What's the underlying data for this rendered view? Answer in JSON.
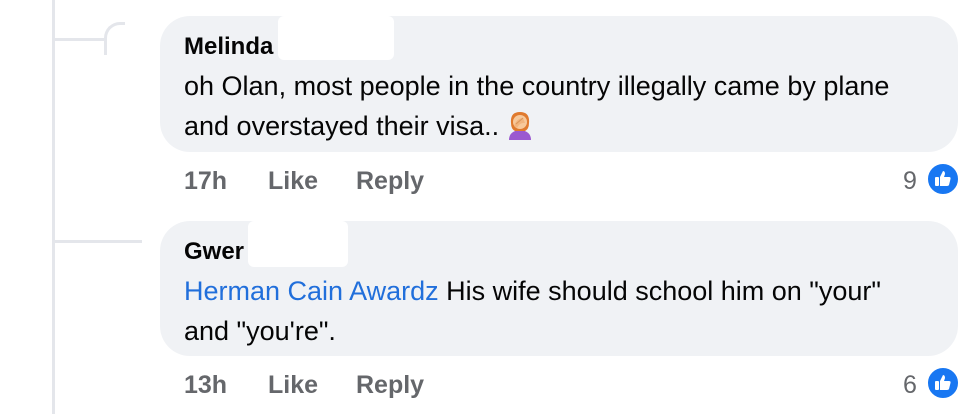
{
  "comments": [
    {
      "author": "Melinda",
      "text": "oh Olan, most people in the country illegally came by plane and overstayed their visa..",
      "emoji": "face-palm-emoji",
      "time": "17h",
      "like_label": "Like",
      "reply_label": "Reply",
      "reaction_count": "9"
    },
    {
      "author": "Gwer",
      "mention": "Herman Cain Awardz",
      "text": "His wife should school him on \"your\" and \"you're\".",
      "time": "13h",
      "like_label": "Like",
      "reply_label": "Reply",
      "reaction_count": "6"
    }
  ],
  "colors": {
    "bubble": "#f0f2f5",
    "mention": "#216fdb",
    "meta": "#65676b",
    "like": "#1877f2"
  }
}
